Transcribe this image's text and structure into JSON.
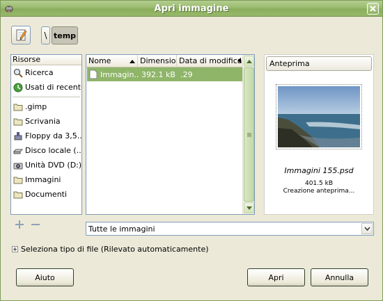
{
  "window": {
    "title": "Apri immagine"
  },
  "places": {
    "header": "Risorse",
    "items": [
      {
        "label": "Ricerca",
        "icon": "search-icon"
      },
      {
        "label": "Usati di recente",
        "icon": "recent-icon"
      },
      {
        "label": ".gimp",
        "icon": "folder-icon"
      },
      {
        "label": "Scrivania",
        "icon": "folder-icon"
      },
      {
        "label": "Floppy da 3,5...",
        "icon": "floppy-icon"
      },
      {
        "label": "Disco locale (...",
        "icon": "disk-icon"
      },
      {
        "label": "Unità DVD (D:)",
        "icon": "dvd-icon"
      },
      {
        "label": "Immagini",
        "icon": "folder-icon"
      },
      {
        "label": "Documenti",
        "icon": "folder-icon"
      }
    ]
  },
  "path": {
    "separator": "\\",
    "current": "temp"
  },
  "files": {
    "columns": {
      "name": "Nome",
      "size": "Dimensione",
      "date": "Data di modifica"
    },
    "rows": [
      {
        "name": "Immagin...",
        "size": "392.1 kB",
        "date": ".29"
      }
    ]
  },
  "preview": {
    "button": "Anteprima",
    "filename": "Immagini 155.psd",
    "size": "401.5 kB",
    "status": "Creazione anteprima..."
  },
  "filter": {
    "selected": "Tutte le immagini"
  },
  "expander": {
    "label": "Seleziona tipo di file (Rilevato automaticamente)"
  },
  "buttons": {
    "help": "Aiuto",
    "open": "Apri",
    "cancel": "Annulla"
  },
  "colors": {
    "titlebar": "#9bbb70",
    "selection": "#8fb569",
    "dialog_bg": "#ece9d8"
  }
}
